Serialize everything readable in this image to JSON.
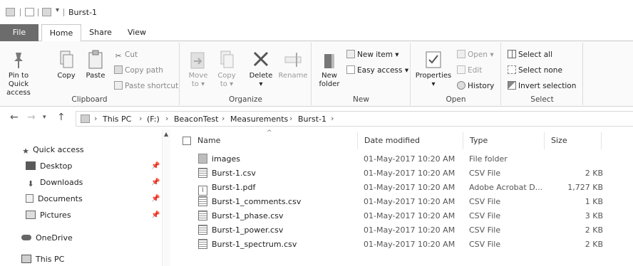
{
  "window": {
    "title": "Burst-1"
  },
  "ribbon_tabs": [
    {
      "label": "File"
    },
    {
      "label": "Home"
    },
    {
      "label": "Share"
    },
    {
      "label": "View"
    }
  ],
  "clipboard": {
    "pin_line1": "Pin to Quick",
    "pin_line2": "access",
    "copy": "Copy",
    "paste": "Paste",
    "cut": "Cut",
    "copy_path": "Copy path",
    "paste_shortcut": "Paste shortcut",
    "group_label": "Clipboard"
  },
  "organize": {
    "move_to": "Move",
    "move_to_2": "to",
    "copy_to": "Copy",
    "copy_to_2": "to",
    "delete": "Delete",
    "rename": "Rename",
    "group_label": "Organize"
  },
  "new_group": {
    "new_folder_1": "New",
    "new_folder_2": "folder",
    "new_item": "New item",
    "easy_access": "Easy access",
    "group_label": "New"
  },
  "open_group": {
    "properties": "Properties",
    "open": "Open",
    "edit": "Edit",
    "history": "History",
    "group_label": "Open"
  },
  "select_group": {
    "select_all": "Select all",
    "select_none": "Select none",
    "invert_selection": "Invert selection",
    "group_label": "Select"
  },
  "address": {
    "crumbs": [
      "This PC",
      "(F:)",
      "BeaconTest",
      "Measurements",
      "Burst-1"
    ]
  },
  "nav": {
    "quick_access": "Quick access",
    "items": [
      {
        "label": "Desktop"
      },
      {
        "label": "Downloads"
      },
      {
        "label": "Documents"
      },
      {
        "label": "Pictures"
      }
    ],
    "onedrive": "OneDrive",
    "this_pc": "This PC"
  },
  "columns": {
    "name": "Name",
    "date_modified": "Date modified",
    "type": "Type",
    "size": "Size"
  },
  "files": [
    {
      "name": "images",
      "date": "01-May-2017 10:20 AM",
      "type": "File folder",
      "size": ""
    },
    {
      "name": "Burst-1.csv",
      "date": "01-May-2017 10:20 AM",
      "type": "CSV File",
      "size": "2 KB"
    },
    {
      "name": "Burst-1.pdf",
      "date": "01-May-2017 10:20 AM",
      "type": "Adobe Acrobat D...",
      "size": "1,727 KB"
    },
    {
      "name": "Burst-1_comments.csv",
      "date": "01-May-2017 10:20 AM",
      "type": "CSV File",
      "size": "1 KB"
    },
    {
      "name": "Burst-1_phase.csv",
      "date": "01-May-2017 10:20 AM",
      "type": "CSV File",
      "size": "3 KB"
    },
    {
      "name": "Burst-1_power.csv",
      "date": "01-May-2017 10:20 AM",
      "type": "CSV File",
      "size": "2 KB"
    },
    {
      "name": "Burst-1_spectrum.csv",
      "date": "01-May-2017 10:20 AM",
      "type": "CSV File",
      "size": "2 KB"
    }
  ]
}
